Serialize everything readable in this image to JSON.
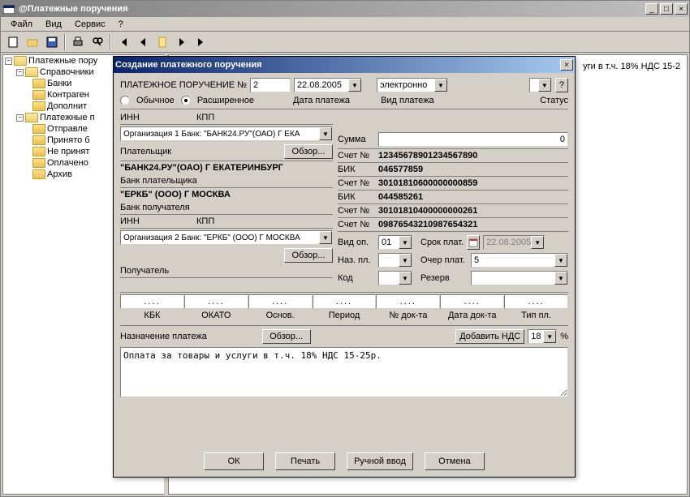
{
  "window": {
    "title": "@Платежные поручения"
  },
  "menu": {
    "file": "Файл",
    "view": "Вид",
    "service": "Сервис",
    "help": "?"
  },
  "tree": {
    "root": "Платежные пору",
    "ref": "Справочники",
    "banks": "Банки",
    "contragents": "Контраген",
    "additional": "Дополнит",
    "payments": "Платежные п",
    "sent": "Отправле",
    "accepted": "Принято б",
    "notaccepted": "Не принят",
    "paid": "Оплачено",
    "archive": "Архив"
  },
  "rightpane_text": "уги в т.ч. 18% НДС 15-2",
  "dialog": {
    "title": "Создание платежного поручения",
    "header_lbl": "ПЛАТЕЖНОЕ ПОРУЧЕНИЕ №",
    "number": "2",
    "date": "22.08.2005",
    "date_lbl": "Дата платежа",
    "payment_type": "электронно",
    "payment_type_lbl": "Вид платежа",
    "status_lbl": "Статус",
    "variant_std": "Обычное",
    "variant_ext": "Расширенное",
    "inn_lbl": "ИНН",
    "kpp_lbl": "КПП",
    "org1_select": "Организация 1    Банк: \"БАНК24.РУ\"(ОАО) Г ЕКА",
    "amount_lbl": "Сумма",
    "amount_val": "0",
    "payer_lbl": "Плательщик",
    "browse_btn": "Обзор...",
    "payer_bank": "\"БАНК24.РУ\"(ОАО) Г ЕКАТЕРИНБУРГ",
    "payer_bank_lbl": "Банк плательщика",
    "receiver_bank": "\"ЕРКБ\" (ООО) Г МОСКВА",
    "receiver_bank_lbl": "Банк получателя",
    "org2_select": "Организация 2    Банк: \"ЕРКБ\" (ООО) Г МОСКВА",
    "receiver_lbl": "Получатель",
    "acc_lbl": "Счет №",
    "bik_lbl": "БИК",
    "acc_payer": "12345678901234567890",
    "bik_payer": "046577859",
    "acc_payerbank": "30101810600000000859",
    "bik_receiver": "044585261",
    "acc_receiverbank": "30101810400000000261",
    "acc_receiver": "098765432109876543​21",
    "vidop_lbl": "Вид оп.",
    "vidop_val": "01",
    "srok_lbl": "Срок плат.",
    "srok_val": "22.08.2005",
    "nazpl_lbl": "Наз. пл.",
    "ocher_lbl": "Очер плат.",
    "ocher_val": "5",
    "kod_lbl": "Код",
    "rezerv_lbl": "Резерв",
    "cols": {
      "kbk": "КБК",
      "okato": "ОКАТО",
      "osnov": "Основ.",
      "period": "Период",
      "ndoc": "№ док-та",
      "ddate": "Дата док-та",
      "type": "Тип пл."
    },
    "purpose_lbl": "Назначение платежа",
    "addvat_btn": "Добавить НДС",
    "vat_pct": "18",
    "purpose_text": "Оплата за товары и услуги в т.ч. 18% НДС 15-25р.",
    "ok_btn": "ОК",
    "print_btn": "Печать",
    "manual_btn": "Ручной ввод",
    "cancel_btn": "Отмена",
    "q_mark": "?"
  }
}
